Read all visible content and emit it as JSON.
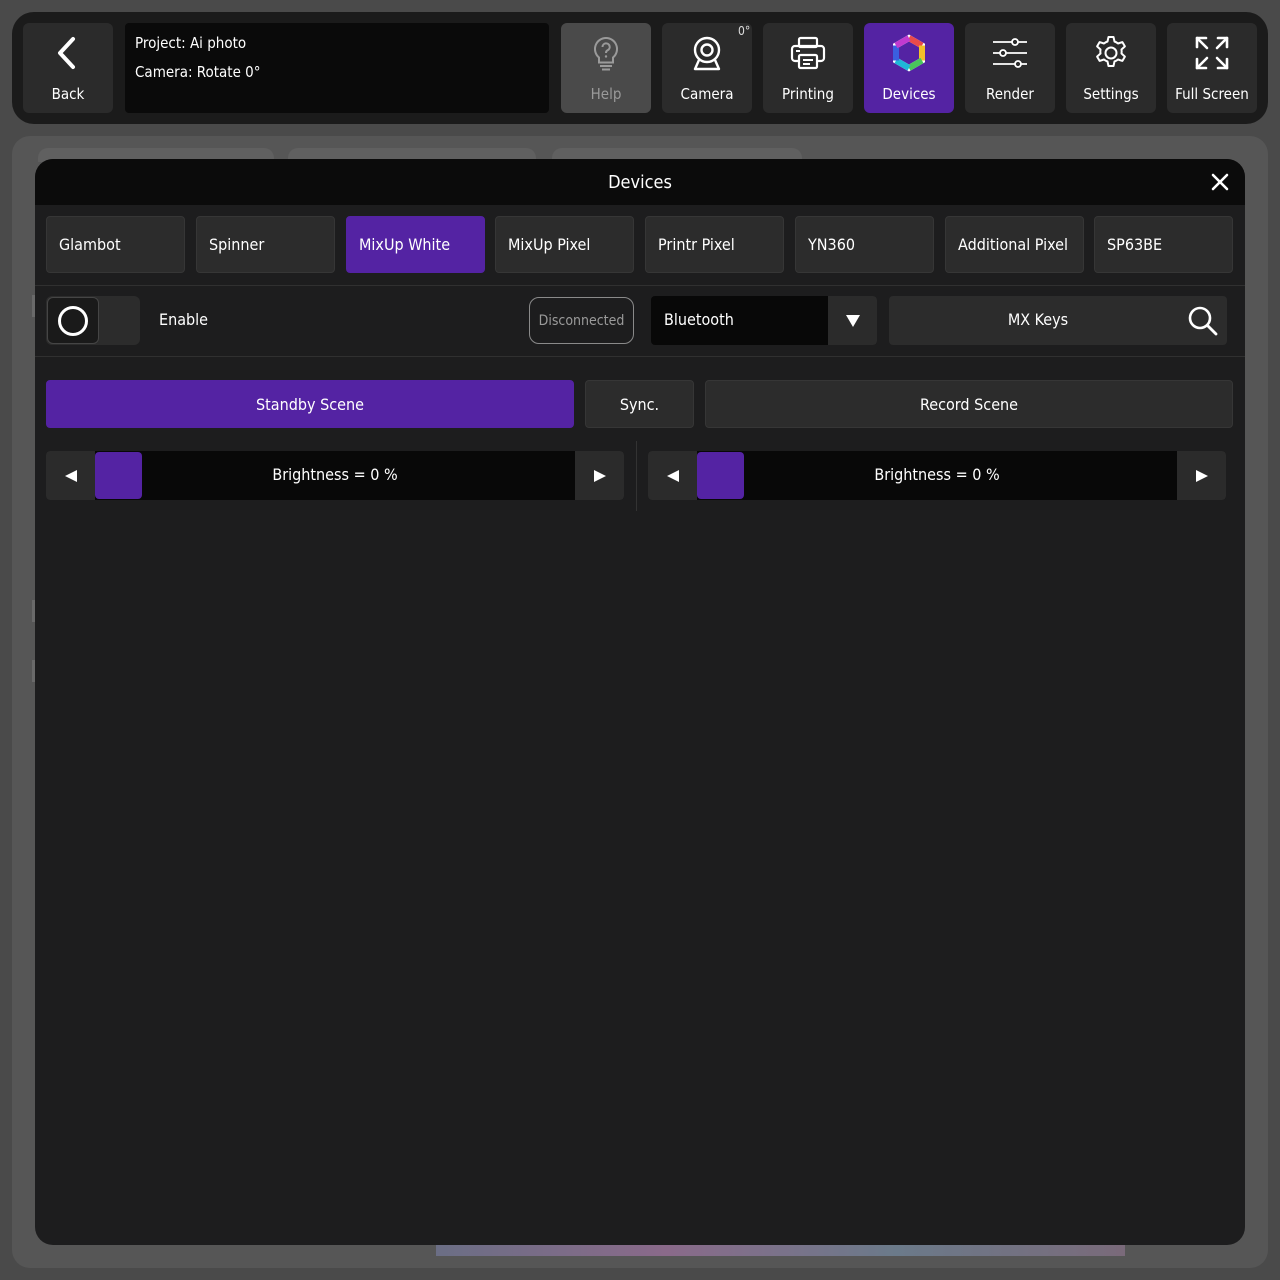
{
  "toolbar": {
    "back_label": "Back",
    "project_line": "Project: Ai photo",
    "camera_line": "Camera: Rotate 0°",
    "rotation_badge": "0°",
    "buttons": [
      {
        "label": "Help",
        "icon": "lightbulb-question-icon",
        "state": "disabled"
      },
      {
        "label": "Camera",
        "icon": "webcam-icon",
        "state": "normal"
      },
      {
        "label": "Printing",
        "icon": "printer-icon",
        "state": "normal"
      },
      {
        "label": "Devices",
        "icon": "devices-hexagon-icon",
        "state": "active"
      },
      {
        "label": "Render",
        "icon": "sliders-icon",
        "state": "normal"
      },
      {
        "label": "Settings",
        "icon": "gear-icon",
        "state": "normal"
      },
      {
        "label": "Full Screen",
        "icon": "expand-arrows-icon",
        "state": "normal"
      }
    ]
  },
  "modal": {
    "title": "Devices",
    "close_icon": "close-icon",
    "device_tabs": [
      {
        "label": "Glambot",
        "active": false
      },
      {
        "label": "Spinner",
        "active": false
      },
      {
        "label": "MixUp White",
        "active": true
      },
      {
        "label": "MixUp Pixel",
        "active": false
      },
      {
        "label": "Printr Pixel",
        "active": false
      },
      {
        "label": "YN360",
        "active": false
      },
      {
        "label": "Additional Pixel",
        "active": false
      },
      {
        "label": "SP63BE",
        "active": false
      }
    ],
    "connection": {
      "enable_label": "Enable",
      "enabled": false,
      "status": "Disconnected",
      "transport_selected": "Bluetooth",
      "device_name": "MX Keys"
    },
    "scenes": {
      "standby_label": "Standby Scene",
      "sync_label": "Sync.",
      "record_label": "Record Scene",
      "active": "standby"
    },
    "sliders": [
      {
        "label": "Brightness =  0 %",
        "value_percent": 0
      },
      {
        "label": "Brightness =  0 %",
        "value_percent": 0
      }
    ]
  },
  "colors": {
    "accent": "#5423a3",
    "toolbar_bg": "#1b1b1b",
    "modal_bg": "#1d1d1e",
    "button_bg": "#2c2c2c"
  }
}
